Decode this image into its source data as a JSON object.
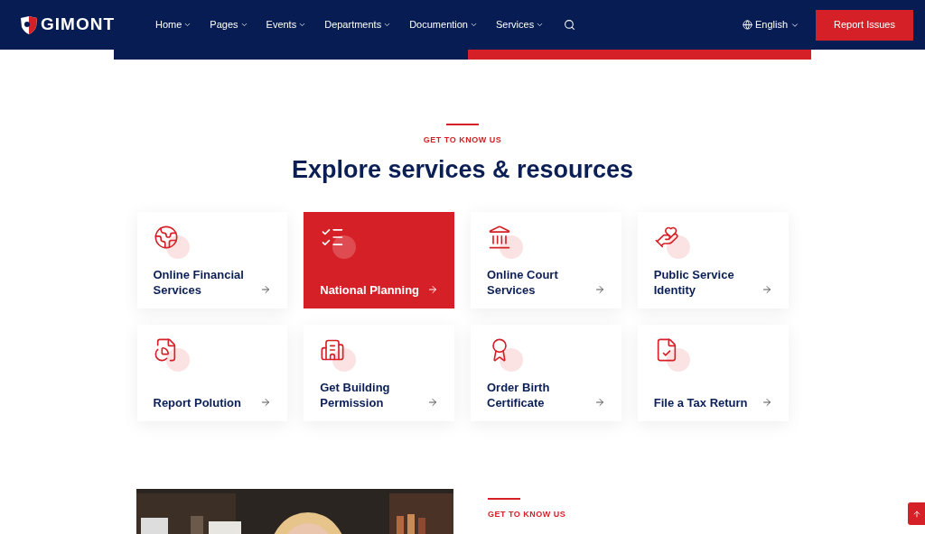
{
  "header": {
    "logo": "GIMONT",
    "nav": [
      {
        "label": "Home",
        "selected": false
      },
      {
        "label": "Pages",
        "selected": false
      },
      {
        "label": "Events",
        "selected": false
      },
      {
        "label": "Departments",
        "selected": false
      },
      {
        "label": "Documention",
        "selected": false
      },
      {
        "label": "Services",
        "selected": false
      }
    ],
    "language": "English",
    "cta": "Report Issues"
  },
  "services": {
    "eyebrow": "GET TO KNOW US",
    "title": "Explore services & resources",
    "cards": [
      {
        "label": "Online Financial Services",
        "selected": false
      },
      {
        "label": "National Planning",
        "selected": true
      },
      {
        "label": "Online Court Services",
        "selected": false
      },
      {
        "label": "Public Service Identity",
        "selected": false
      },
      {
        "label": "Report Polution",
        "selected": false
      },
      {
        "label": "Get Building Permission",
        "selected": false
      },
      {
        "label": "Order Birth Certificate",
        "selected": false
      },
      {
        "label": "File a Tax Return",
        "selected": false
      }
    ]
  },
  "about": {
    "eyebrow": "GET TO KNOW US"
  }
}
